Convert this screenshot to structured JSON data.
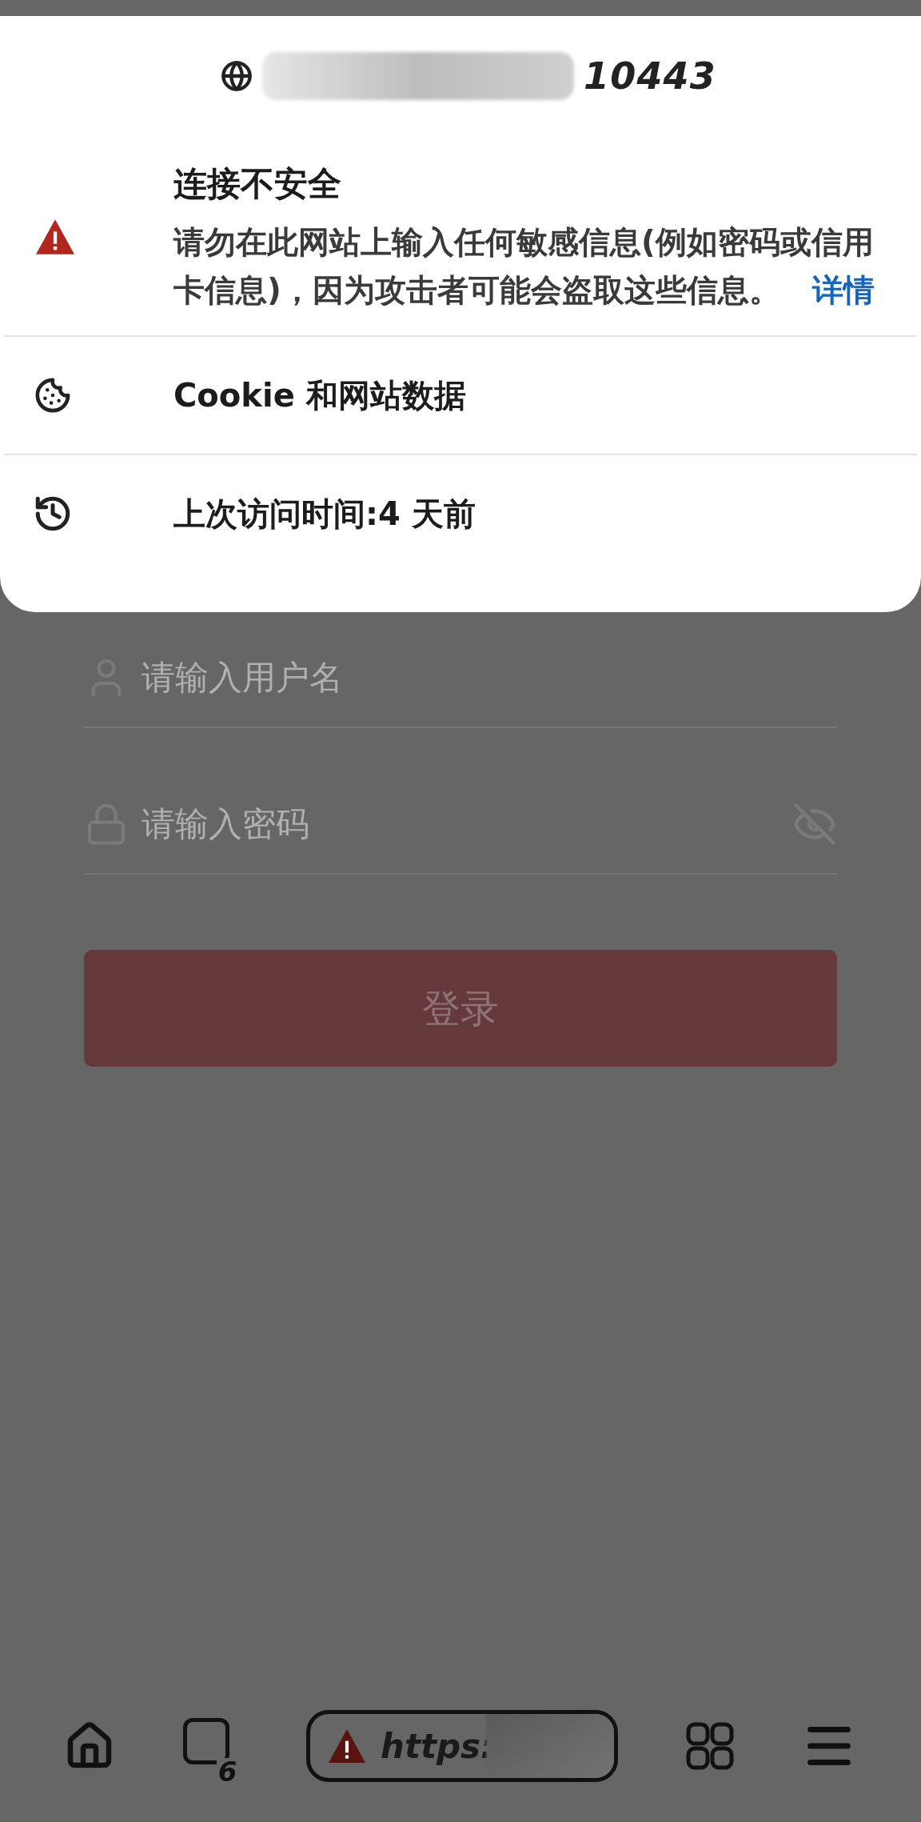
{
  "site_info": {
    "port": "10443",
    "security": {
      "title": "连接不安全",
      "message": "请勿在此网站上输入任何敏感信息(例如密码或信用卡信息)，因为攻击者可能会盗取这些信息。",
      "link": "详情"
    },
    "rows": [
      {
        "kind": "cookie",
        "label": "Cookie 和网站数据"
      },
      {
        "kind": "history",
        "label": "上次访问时间:4 天前"
      }
    ]
  },
  "login_form": {
    "username": {
      "placeholder": "请输入用户名"
    },
    "password": {
      "placeholder": "请输入密码",
      "visible": false
    },
    "submit": "登录"
  },
  "toolbar": {
    "tab_count": "6",
    "url": "https:"
  }
}
